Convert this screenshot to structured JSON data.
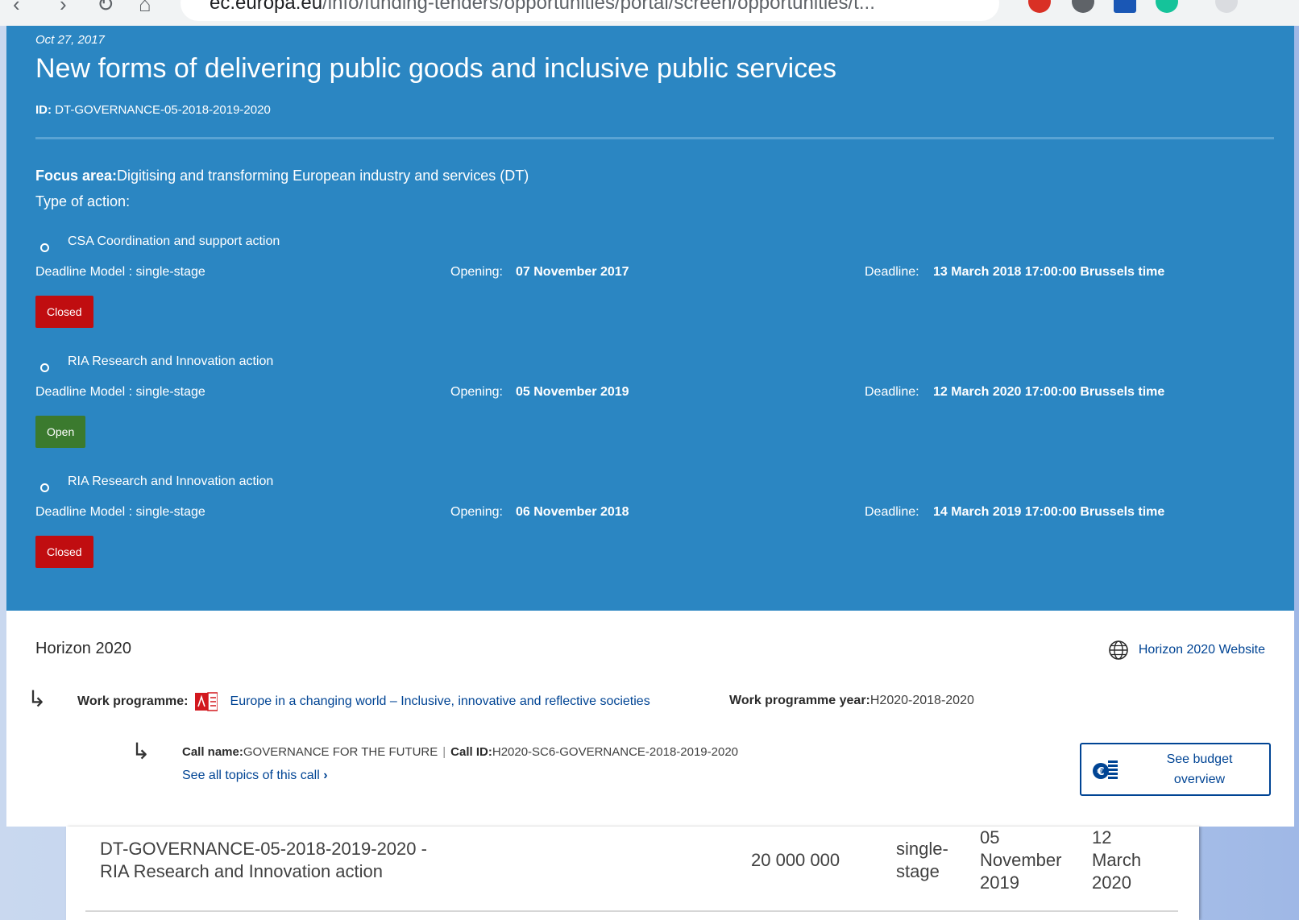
{
  "browser": {
    "url_host": "ec.europa.eu",
    "url_path": "/info/funding-tenders/opportunities/portal/screen/opportunities/t..."
  },
  "topic": {
    "date": "Oct 27, 2017",
    "title": "New forms of delivering public goods and inclusive public services",
    "id_label": "ID:",
    "id_value": "DT-GOVERNANCE-05-2018-2019-2020",
    "focus_label": "Focus area:",
    "focus_value": "Digitising and transforming European industry and services (DT)",
    "type_label": "Type of action:"
  },
  "actions": [
    {
      "name": "CSA Coordination and support action",
      "model": "Deadline Model : single-stage",
      "opening_label": "Opening:",
      "opening": "07 November 2017",
      "deadline_label": "Deadline:",
      "deadline": "13 March 2018 17:00:00 Brussels time",
      "status": "Closed"
    },
    {
      "name": "RIA Research and Innovation action",
      "model": "Deadline Model : single-stage",
      "opening_label": "Opening:",
      "opening": "05 November 2019",
      "deadline_label": "Deadline:",
      "deadline": "12 March 2020 17:00:00 Brussels time",
      "status": "Open"
    },
    {
      "name": "RIA Research and Innovation action",
      "model": "Deadline Model : single-stage",
      "opening_label": "Opening:",
      "opening": "06 November 2018",
      "deadline_label": "Deadline:",
      "deadline": "14 March 2019 17:00:00 Brussels time",
      "status": "Closed"
    }
  ],
  "programme": {
    "name": "Horizon 2020",
    "website_label": "Horizon 2020 Website",
    "wp_label": "Work programme:",
    "wp_link": "Europe in a changing world – Inclusive, innovative and reflective societies",
    "wp_year_label": "Work programme year:",
    "wp_year": "H2020-2018-2020",
    "call_name_label": "Call name:",
    "call_name": "GOVERNANCE FOR THE FUTURE",
    "separator": "|",
    "call_id_label": "Call ID:",
    "call_id": "H2020-SC6-GOVERNANCE-2018-2019-2020",
    "see_topics": "See all topics of this call",
    "budget_button": "See budget overview"
  },
  "budget_row": {
    "topic": "DT-GOVERNANCE-05-2018-2019-2020 - RIA Research and Innovation action",
    "amount": "20 000 000",
    "stage": "single-stage",
    "opening": "05 November 2019",
    "deadline": "12 March 2020"
  },
  "colors": {
    "hero_bg": "#2b86c2",
    "closed": "#c00d10",
    "open": "#3b7a2e",
    "link": "#004494"
  }
}
